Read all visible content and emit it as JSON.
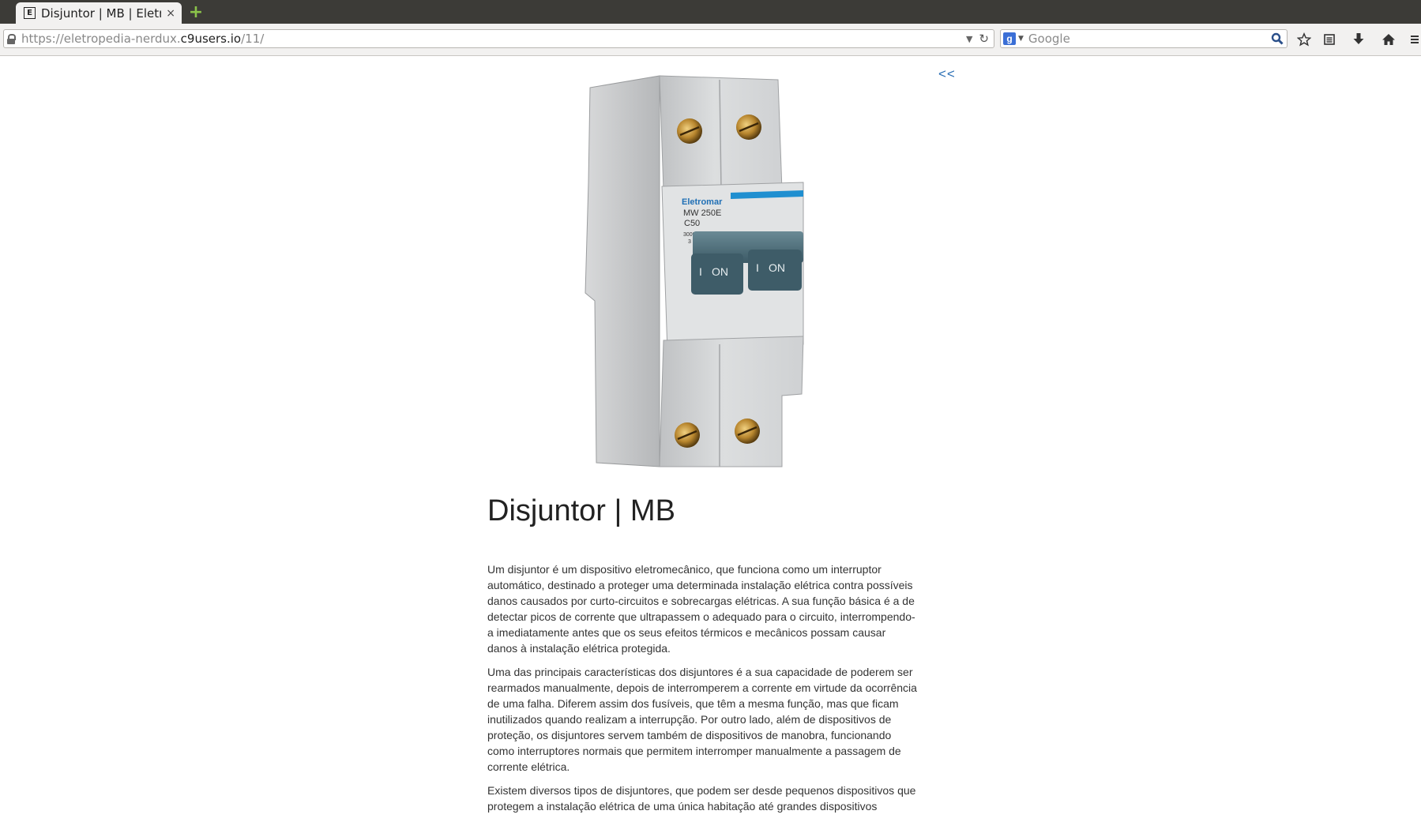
{
  "browser": {
    "tab": {
      "favicon_letter": "E",
      "title": "Disjuntor | MB | Eletr…",
      "close_glyph": "×"
    },
    "new_tab_glyph": "+",
    "url": {
      "prefix": "https://eletropedia-nerdux.",
      "host": "c9users.io",
      "path": "/11/"
    },
    "search": {
      "engine_letter": "g",
      "placeholder": "Google"
    },
    "toolbar_icons": [
      "star-icon",
      "reading-list-icon",
      "download-icon",
      "home-icon",
      "menu-icon"
    ]
  },
  "page": {
    "back_link": "<<",
    "product_image": {
      "brand": "Eletromar",
      "model": "MW 250E",
      "rating": "C50",
      "capacity": "3000",
      "class_mark": "3",
      "switch_text_on": "ON",
      "switch_text_i": "I"
    },
    "title": "Disjuntor | MB",
    "paragraphs": [
      "Um disjuntor é um dispositivo eletromecânico, que funciona como um interruptor automático, destinado a proteger uma determinada instalação elétrica contra possíveis danos causados por curto-circuitos e sobrecargas elétricas. A sua função básica é a de detectar picos de corrente que ultrapassem o adequado para o circuito, interrompendo-a imediatamente antes que os seus efeitos térmicos e mecânicos possam causar danos à instalação elétrica protegida.",
      "Uma das principais características dos disjuntores é a sua capacidade de poderem ser rearmados manualmente, depois de interromperem a corrente em virtude da ocorrência de uma falha. Diferem assim dos fusíveis, que têm a mesma função, mas que ficam inutilizados quando realizam a interrupção. Por outro lado, além de dispositivos de proteção, os disjuntores servem também de dispositivos de manobra, funcionando como interruptores normais que permitem interromper manualmente a passagem de corrente elétrica.",
      "Existem diversos tipos de disjuntores, que podem ser desde pequenos dispositivos que protegem a instalação elétrica de uma única habitação até grandes dispositivos"
    ]
  }
}
